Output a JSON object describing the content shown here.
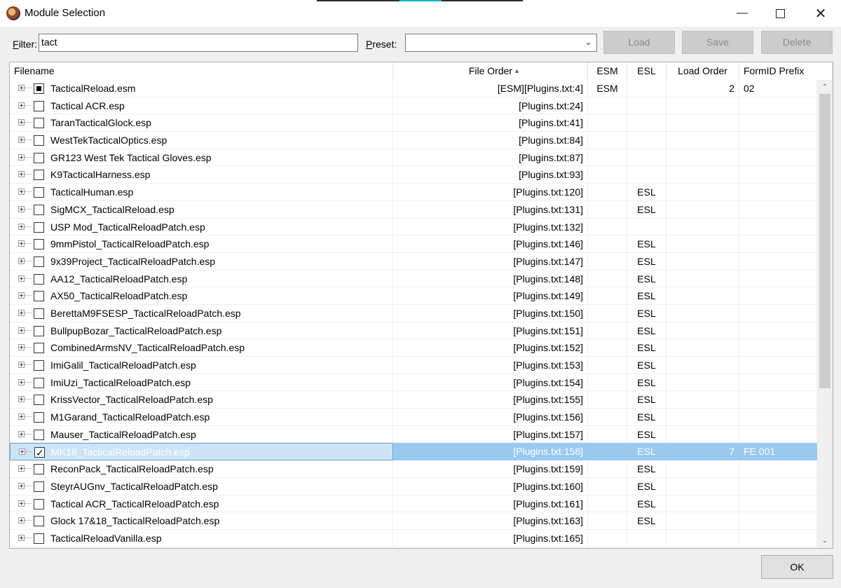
{
  "window": {
    "title": "Module Selection"
  },
  "toolbar": {
    "filter_label_u": "F",
    "filter_label_rest": "ilter:",
    "filter_value": "tact",
    "preset_label_u": "P",
    "preset_label_rest": "reset:",
    "preset_value": "",
    "load_label": "Load",
    "save_label": "Save",
    "delete_label": "Delete"
  },
  "columns": {
    "filename": "Filename",
    "file_order": "File Order",
    "esm": "ESM",
    "esl": "ESL",
    "load_order": "Load Order",
    "formid_prefix": "FormID Prefix"
  },
  "rows": [
    {
      "name": "TacticalReload.esm",
      "order": "[ESM][Plugins.txt:4]",
      "esm": "ESM",
      "esl": "",
      "load_order": "2",
      "formid": "02",
      "check": "partial"
    },
    {
      "name": "Tactical ACR.esp",
      "order": "[Plugins.txt:24]",
      "esm": "",
      "esl": "",
      "load_order": "",
      "formid": "",
      "check": "none"
    },
    {
      "name": "TaranTacticalGlock.esp",
      "order": "[Plugins.txt:41]",
      "esm": "",
      "esl": "",
      "load_order": "",
      "formid": "",
      "check": "none"
    },
    {
      "name": "WestTekTacticalOptics.esp",
      "order": "[Plugins.txt:84]",
      "esm": "",
      "esl": "",
      "load_order": "",
      "formid": "",
      "check": "none"
    },
    {
      "name": "GR123 West Tek Tactical Gloves.esp",
      "order": "[Plugins.txt:87]",
      "esm": "",
      "esl": "",
      "load_order": "",
      "formid": "",
      "check": "none"
    },
    {
      "name": "K9TacticalHarness.esp",
      "order": "[Plugins.txt:93]",
      "esm": "",
      "esl": "",
      "load_order": "",
      "formid": "",
      "check": "none"
    },
    {
      "name": "TacticalHuman.esp",
      "order": "[Plugins.txt:120]",
      "esm": "",
      "esl": "ESL",
      "load_order": "",
      "formid": "",
      "check": "none"
    },
    {
      "name": "SigMCX_TacticalReload.esp",
      "order": "[Plugins.txt:131]",
      "esm": "",
      "esl": "ESL",
      "load_order": "",
      "formid": "",
      "check": "none"
    },
    {
      "name": "USP Mod_TacticalReloadPatch.esp",
      "order": "[Plugins.txt:132]",
      "esm": "",
      "esl": "",
      "load_order": "",
      "formid": "",
      "check": "none"
    },
    {
      "name": "9mmPistol_TacticalReloadPatch.esp",
      "order": "[Plugins.txt:146]",
      "esm": "",
      "esl": "ESL",
      "load_order": "",
      "formid": "",
      "check": "none"
    },
    {
      "name": "9x39Project_TacticalReloadPatch.esp",
      "order": "[Plugins.txt:147]",
      "esm": "",
      "esl": "ESL",
      "load_order": "",
      "formid": "",
      "check": "none"
    },
    {
      "name": "AA12_TacticalReloadPatch.esp",
      "order": "[Plugins.txt:148]",
      "esm": "",
      "esl": "ESL",
      "load_order": "",
      "formid": "",
      "check": "none"
    },
    {
      "name": "AX50_TacticalReloadPatch.esp",
      "order": "[Plugins.txt:149]",
      "esm": "",
      "esl": "ESL",
      "load_order": "",
      "formid": "",
      "check": "none"
    },
    {
      "name": "BerettaM9FSESP_TacticalReloadPatch.esp",
      "order": "[Plugins.txt:150]",
      "esm": "",
      "esl": "ESL",
      "load_order": "",
      "formid": "",
      "check": "none"
    },
    {
      "name": "BullpupBozar_TacticalReloadPatch.esp",
      "order": "[Plugins.txt:151]",
      "esm": "",
      "esl": "ESL",
      "load_order": "",
      "formid": "",
      "check": "none"
    },
    {
      "name": "CombinedArmsNV_TacticalReloadPatch.esp",
      "order": "[Plugins.txt:152]",
      "esm": "",
      "esl": "ESL",
      "load_order": "",
      "formid": "",
      "check": "none"
    },
    {
      "name": "ImiGalil_TacticalReloadPatch.esp",
      "order": "[Plugins.txt:153]",
      "esm": "",
      "esl": "ESL",
      "load_order": "",
      "formid": "",
      "check": "none"
    },
    {
      "name": "ImiUzi_TacticalReloadPatch.esp",
      "order": "[Plugins.txt:154]",
      "esm": "",
      "esl": "ESL",
      "load_order": "",
      "formid": "",
      "check": "none"
    },
    {
      "name": "KrissVector_TacticalReloadPatch.esp",
      "order": "[Plugins.txt:155]",
      "esm": "",
      "esl": "ESL",
      "load_order": "",
      "formid": "",
      "check": "none"
    },
    {
      "name": "M1Garand_TacticalReloadPatch.esp",
      "order": "[Plugins.txt:156]",
      "esm": "",
      "esl": "ESL",
      "load_order": "",
      "formid": "",
      "check": "none"
    },
    {
      "name": "Mauser_TacticalReloadPatch.esp",
      "order": "[Plugins.txt:157]",
      "esm": "",
      "esl": "ESL",
      "load_order": "",
      "formid": "",
      "check": "none"
    },
    {
      "name": "MK18_TacticalReloadPatch.esp",
      "order": "[Plugins.txt:158]",
      "esm": "",
      "esl": "ESL",
      "load_order": "7",
      "formid": "FE 001",
      "check": "checked",
      "selected": true
    },
    {
      "name": "ReconPack_TacticalReloadPatch.esp",
      "order": "[Plugins.txt:159]",
      "esm": "",
      "esl": "ESL",
      "load_order": "",
      "formid": "",
      "check": "none"
    },
    {
      "name": "SteyrAUGnv_TacticalReloadPatch.esp",
      "order": "[Plugins.txt:160]",
      "esm": "",
      "esl": "ESL",
      "load_order": "",
      "formid": "",
      "check": "none"
    },
    {
      "name": "Tactical ACR_TacticalReloadPatch.esp",
      "order": "[Plugins.txt:161]",
      "esm": "",
      "esl": "ESL",
      "load_order": "",
      "formid": "",
      "check": "none"
    },
    {
      "name": "Glock 17&18_TacticalReloadPatch.esp",
      "order": "[Plugins.txt:163]",
      "esm": "",
      "esl": "ESL",
      "load_order": "",
      "formid": "",
      "check": "none"
    },
    {
      "name": "TacticalReloadVanilla.esp",
      "order": "[Plugins.txt:165]",
      "esm": "",
      "esl": "",
      "load_order": "",
      "formid": "",
      "check": "none"
    }
  ],
  "footer": {
    "ok_label": "OK"
  },
  "colors": {
    "selection": "#99c9ef",
    "accent_strip": "#00b7c3",
    "dark_strip": "#2b2b2b"
  }
}
